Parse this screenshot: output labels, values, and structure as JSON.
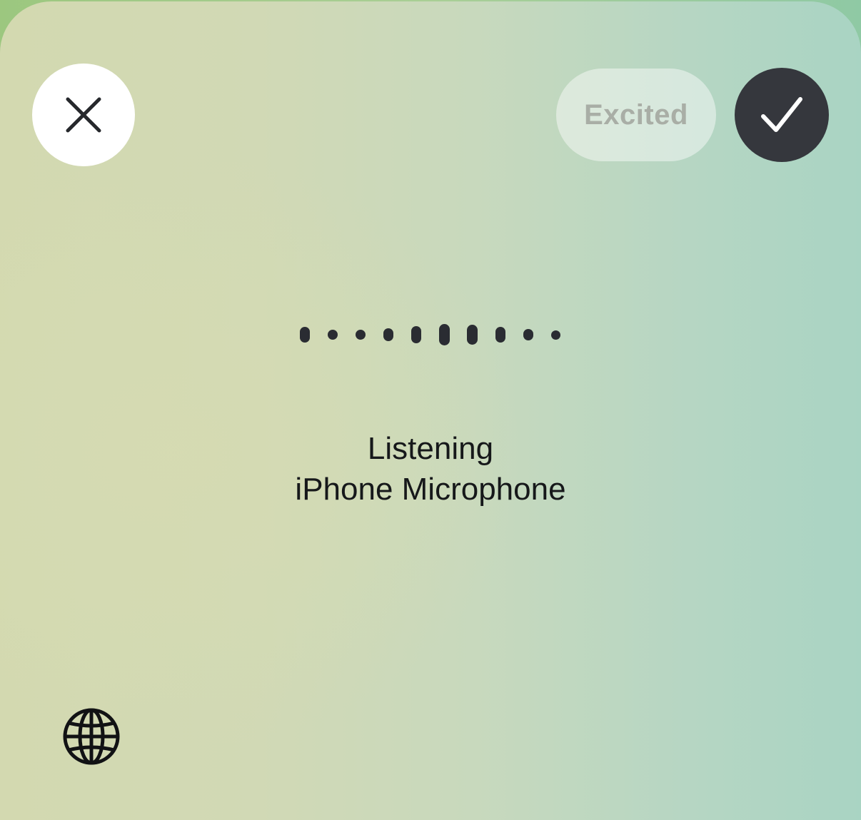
{
  "header": {
    "close_icon": "close-icon",
    "mood_label": "Excited",
    "confirm_icon": "checkmark-icon"
  },
  "listening": {
    "waveform_icon": "waveform-icon",
    "status_line1": "Listening",
    "status_line2": "iPhone Microphone"
  },
  "footer": {
    "globe_icon": "globe-icon"
  },
  "colors": {
    "sheet_left": "#d3d9b0",
    "sheet_right": "#a9d4c3",
    "confirm_bg": "#35373d",
    "mood_text": "#a9aea6"
  }
}
